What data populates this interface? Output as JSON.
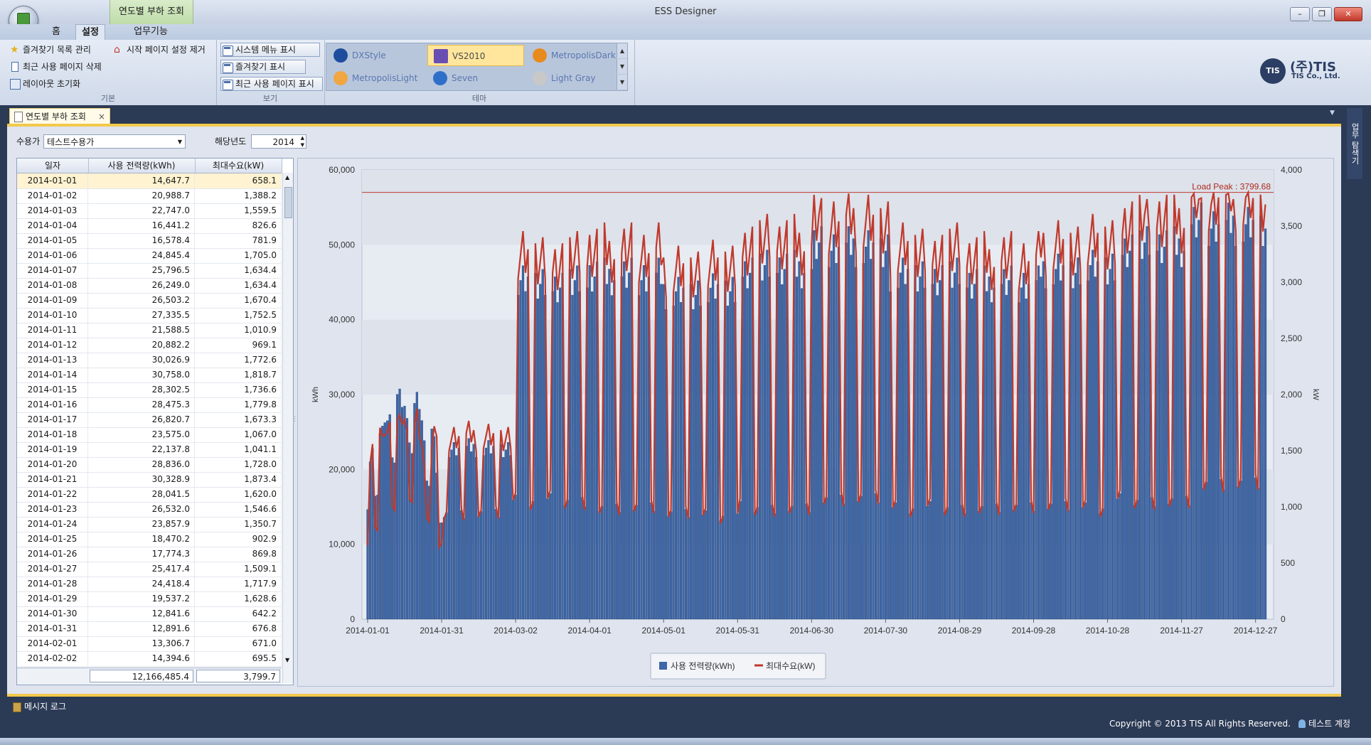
{
  "window": {
    "title": "ESS Designer",
    "context_tab": "연도별 부하 조회"
  },
  "ribbon": {
    "tabs": [
      "홈",
      "설정",
      "업무기능"
    ],
    "active_tab": "설정",
    "groups": {
      "basic": {
        "caption": "기본",
        "items": [
          "즐겨찾기 목록 관리",
          "시작 페이지 설정 제거",
          "최근 사용 페이지 삭제",
          "레이아웃 초기화"
        ]
      },
      "view": {
        "caption": "보기",
        "items": [
          "시스템 메뉴 표시",
          "즐겨찾기 표시",
          "최근 사용 페이지 표시"
        ]
      },
      "theme": {
        "caption": "테마",
        "items": [
          {
            "name": "DXStyle",
            "color": "#1f4d9e"
          },
          {
            "name": "VS2010",
            "color": "#6a4fb3"
          },
          {
            "name": "MetropolisDark",
            "color": "#e88b1f"
          },
          {
            "name": "MetropolisLight",
            "color": "#f0a742"
          },
          {
            "name": "Seven",
            "color": "#2f6fc9"
          },
          {
            "name": "Light Gray",
            "color": "#c8c8c8"
          }
        ],
        "selected": "VS2010"
      }
    },
    "logo": {
      "mark": "TIS",
      "name": "(주)TIS",
      "sub": "TIS Co., Ltd."
    }
  },
  "document_tab": {
    "label": "연도별 부하 조회",
    "close": "×"
  },
  "right_panel_tab": "업무 탐색기",
  "filter": {
    "customer_label": "수용가",
    "customer_value": "테스트수용가",
    "year_label": "해당년도",
    "year_value": "2014"
  },
  "grid": {
    "columns": [
      "일자",
      "사용 전력량(kWh)",
      "최대수요(kW)"
    ],
    "rows": [
      [
        "2014-01-01",
        "14,647.7",
        "658.1"
      ],
      [
        "2014-01-02",
        "20,988.7",
        "1,388.2"
      ],
      [
        "2014-01-03",
        "22,747.0",
        "1,559.5"
      ],
      [
        "2014-01-04",
        "16,441.2",
        "826.6"
      ],
      [
        "2014-01-05",
        "16,578.4",
        "781.9"
      ],
      [
        "2014-01-06",
        "24,845.4",
        "1,705.0"
      ],
      [
        "2014-01-07",
        "25,796.5",
        "1,634.4"
      ],
      [
        "2014-01-08",
        "26,249.0",
        "1,634.4"
      ],
      [
        "2014-01-09",
        "26,503.2",
        "1,670.4"
      ],
      [
        "2014-01-10",
        "27,335.5",
        "1,752.5"
      ],
      [
        "2014-01-11",
        "21,588.5",
        "1,010.9"
      ],
      [
        "2014-01-12",
        "20,882.2",
        "969.1"
      ],
      [
        "2014-01-13",
        "30,026.9",
        "1,772.6"
      ],
      [
        "2014-01-14",
        "30,758.0",
        "1,818.7"
      ],
      [
        "2014-01-15",
        "28,302.5",
        "1,736.6"
      ],
      [
        "2014-01-16",
        "28,475.3",
        "1,779.8"
      ],
      [
        "2014-01-17",
        "26,820.7",
        "1,673.3"
      ],
      [
        "2014-01-18",
        "23,575.0",
        "1,067.0"
      ],
      [
        "2014-01-19",
        "22,137.8",
        "1,041.1"
      ],
      [
        "2014-01-20",
        "28,836.0",
        "1,728.0"
      ],
      [
        "2014-01-21",
        "30,328.9",
        "1,873.4"
      ],
      [
        "2014-01-22",
        "28,041.5",
        "1,620.0"
      ],
      [
        "2014-01-23",
        "26,532.0",
        "1,546.6"
      ],
      [
        "2014-01-24",
        "23,857.9",
        "1,350.7"
      ],
      [
        "2014-01-25",
        "18,470.2",
        "902.9"
      ],
      [
        "2014-01-26",
        "17,774.3",
        "869.8"
      ],
      [
        "2014-01-27",
        "25,417.4",
        "1,509.1"
      ],
      [
        "2014-01-28",
        "24,418.4",
        "1,717.9"
      ],
      [
        "2014-01-29",
        "19,537.2",
        "1,628.6"
      ],
      [
        "2014-01-30",
        "12,841.6",
        "642.2"
      ],
      [
        "2014-01-31",
        "12,891.6",
        "676.8"
      ],
      [
        "2014-02-01",
        "13,306.7",
        "671.0"
      ],
      [
        "2014-02-02",
        "14,394.6",
        "695.5"
      ]
    ],
    "totals": [
      "12,166,485.4",
      "3,799.7"
    ]
  },
  "chart_data": {
    "type": "bar",
    "title": "",
    "ylabel": "kWh",
    "y2label": "kW",
    "ylim": [
      0,
      60000
    ],
    "y2lim": [
      0,
      4000
    ],
    "yticks": [
      "0",
      "10,000",
      "20,000",
      "30,000",
      "40,000",
      "50,000",
      "60,000"
    ],
    "y2ticks": [
      "0",
      "500",
      "1,000",
      "1,500",
      "2,000",
      "2,500",
      "3,000",
      "3,500",
      "4,000"
    ],
    "xticks": [
      "2014-01-01",
      "2014-01-31",
      "2014-03-02",
      "2014-04-01",
      "2014-05-01",
      "2014-05-31",
      "2014-06-30",
      "2014-07-30",
      "2014-08-29",
      "2014-09-28",
      "2014-10-28",
      "2014-11-27",
      "2014-12-27"
    ],
    "x_start": "2014-01-01",
    "x_end": "2014-12-31",
    "peak_line": {
      "label": "Load Peak : 3799.68",
      "value": 3799.68,
      "axis": "kW"
    },
    "legend": "bottom-center",
    "series": [
      {
        "name": "사용 전력량(kWh)",
        "kind": "bar",
        "axis": "kWh",
        "color": "#3d67a8",
        "monthly_estimate": [
          {
            "month": "2014-01",
            "weekday": 27000,
            "weekend": 19000
          },
          {
            "month": "2014-02",
            "weekday": 23000,
            "weekend": 14000
          },
          {
            "month": "2014-03",
            "weekday": 45000,
            "weekend": 16000
          },
          {
            "month": "2014-04",
            "weekday": 46000,
            "weekend": 15000
          },
          {
            "month": "2014-05",
            "weekday": 44000,
            "weekend": 14000
          },
          {
            "month": "2014-06",
            "weekday": 47000,
            "weekend": 15000
          },
          {
            "month": "2014-07",
            "weekday": 50000,
            "weekend": 16000
          },
          {
            "month": "2014-08",
            "weekday": 46000,
            "weekend": 15000
          },
          {
            "month": "2014-09",
            "weekday": 45000,
            "weekend": 15000
          },
          {
            "month": "2014-10",
            "weekday": 47000,
            "weekend": 15000
          },
          {
            "month": "2014-11",
            "weekday": 50000,
            "weekend": 16000
          },
          {
            "month": "2014-12",
            "weekday": 53000,
            "weekend": 18000
          }
        ],
        "values_jan": [
          14647.7,
          20988.7,
          22747.0,
          16441.2,
          16578.4,
          24845.4,
          25796.5,
          26249.0,
          26503.2,
          27335.5,
          21588.5,
          20882.2,
          30026.9,
          30758.0,
          28302.5,
          28475.3,
          26820.7,
          23575.0,
          22137.8,
          28836.0,
          30328.9,
          28041.5,
          26532.0,
          23857.9,
          18470.2,
          17774.3,
          25417.4,
          24418.4,
          19537.2,
          12841.6,
          12891.6
        ]
      },
      {
        "name": "최대수요(kW)",
        "kind": "line",
        "axis": "kW",
        "color": "#c0392b",
        "values_jan": [
          658.1,
          1388.2,
          1559.5,
          826.6,
          781.9,
          1705.0,
          1634.4,
          1634.4,
          1670.4,
          1752.5,
          1010.9,
          969.1,
          1772.6,
          1818.7,
          1736.6,
          1779.8,
          1673.3,
          1067.0,
          1041.1,
          1728.0,
          1873.4,
          1620.0,
          1546.6,
          1350.7,
          902.9,
          869.8,
          1509.1,
          1717.9,
          1628.6,
          642.2,
          676.8
        ]
      }
    ]
  },
  "bottom": {
    "message_log": "메시지 로그",
    "copyright": "Copyright © 2013 TIS All Rights Reserved.",
    "account": "테스트 계정"
  }
}
